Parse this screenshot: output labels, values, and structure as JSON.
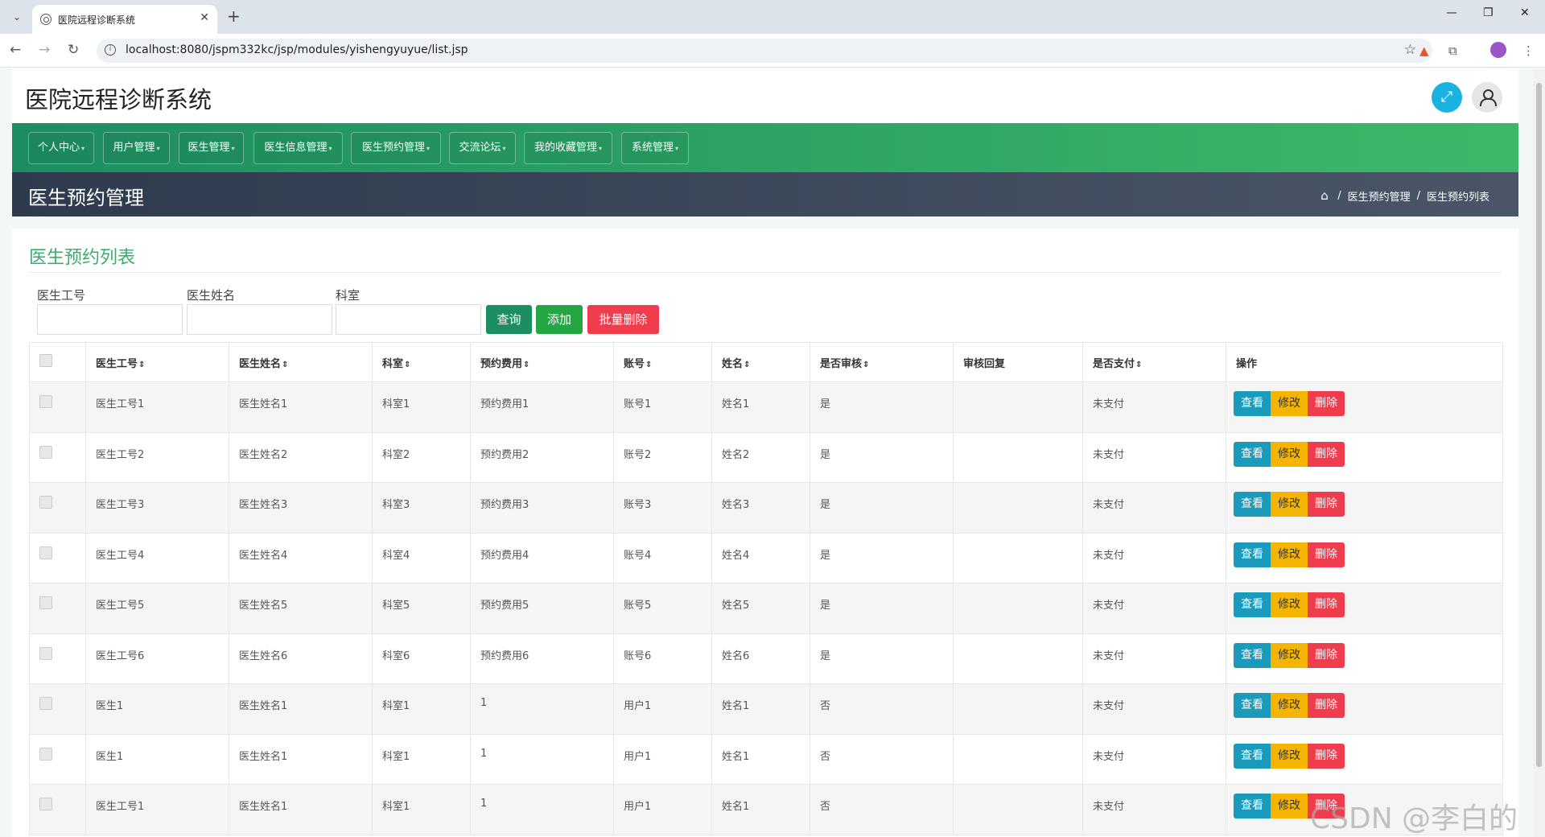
{
  "browser": {
    "tab_title": "医院远程诊断系统",
    "url": "localhost:8080/jspm332kc/jsp/modules/yishengyuyue/list.jsp"
  },
  "header": {
    "site_title": "医院远程诊断系统"
  },
  "nav": {
    "items": [
      "个人中心",
      "用户管理",
      "医生管理",
      "医生信息管理",
      "医生预约管理",
      "交流论坛",
      "我的收藏管理",
      "系统管理"
    ]
  },
  "subbar": {
    "title": "医生预约管理",
    "breadcrumb": [
      "医生预约管理",
      "医生预约列表"
    ]
  },
  "panel": {
    "title": "医生预约列表"
  },
  "search": {
    "fields": [
      "医生工号",
      "医生姓名",
      "科室"
    ],
    "query_label": "查询",
    "add_label": "添加",
    "batch_delete_label": "批量删除"
  },
  "table": {
    "columns": [
      "医生工号",
      "医生姓名",
      "科室",
      "预约费用",
      "账号",
      "姓名",
      "是否审核",
      "审核回复",
      "是否支付",
      "操作"
    ],
    "sortable": [
      true,
      true,
      true,
      true,
      true,
      true,
      true,
      false,
      true,
      false
    ],
    "rows": [
      [
        "医生工号1",
        "医生姓名1",
        "科室1",
        "预约费用1",
        "账号1",
        "姓名1",
        "是",
        "",
        "未支付"
      ],
      [
        "医生工号2",
        "医生姓名2",
        "科室2",
        "预约费用2",
        "账号2",
        "姓名2",
        "是",
        "",
        "未支付"
      ],
      [
        "医生工号3",
        "医生姓名3",
        "科室3",
        "预约费用3",
        "账号3",
        "姓名3",
        "是",
        "",
        "未支付"
      ],
      [
        "医生工号4",
        "医生姓名4",
        "科室4",
        "预约费用4",
        "账号4",
        "姓名4",
        "是",
        "",
        "未支付"
      ],
      [
        "医生工号5",
        "医生姓名5",
        "科室5",
        "预约费用5",
        "账号5",
        "姓名5",
        "是",
        "",
        "未支付"
      ],
      [
        "医生工号6",
        "医生姓名6",
        "科室6",
        "预约费用6",
        "账号6",
        "姓名6",
        "是",
        "",
        "未支付"
      ],
      [
        "医生1",
        "医生姓名1",
        "科室1",
        "1",
        "用户1",
        "姓名1",
        "否",
        "",
        "未支付"
      ],
      [
        "医生1",
        "医生姓名1",
        "科室1",
        "1",
        "用户1",
        "姓名1",
        "否",
        "",
        "未支付"
      ],
      [
        "医生工号1",
        "医生姓名1",
        "科室1",
        "1",
        "用户1",
        "姓名1",
        "否",
        "",
        "未支付"
      ]
    ],
    "actions": {
      "view": "查看",
      "edit": "修改",
      "delete": "删除"
    }
  },
  "watermark": "CSDN @李白的粉",
  "colors": {
    "nav_green": "#1d8e62",
    "title_green": "#3aad6e",
    "view_blue": "#1a9bbb",
    "edit_yellow": "#f5b400",
    "delete_red": "#ef3d4e"
  }
}
